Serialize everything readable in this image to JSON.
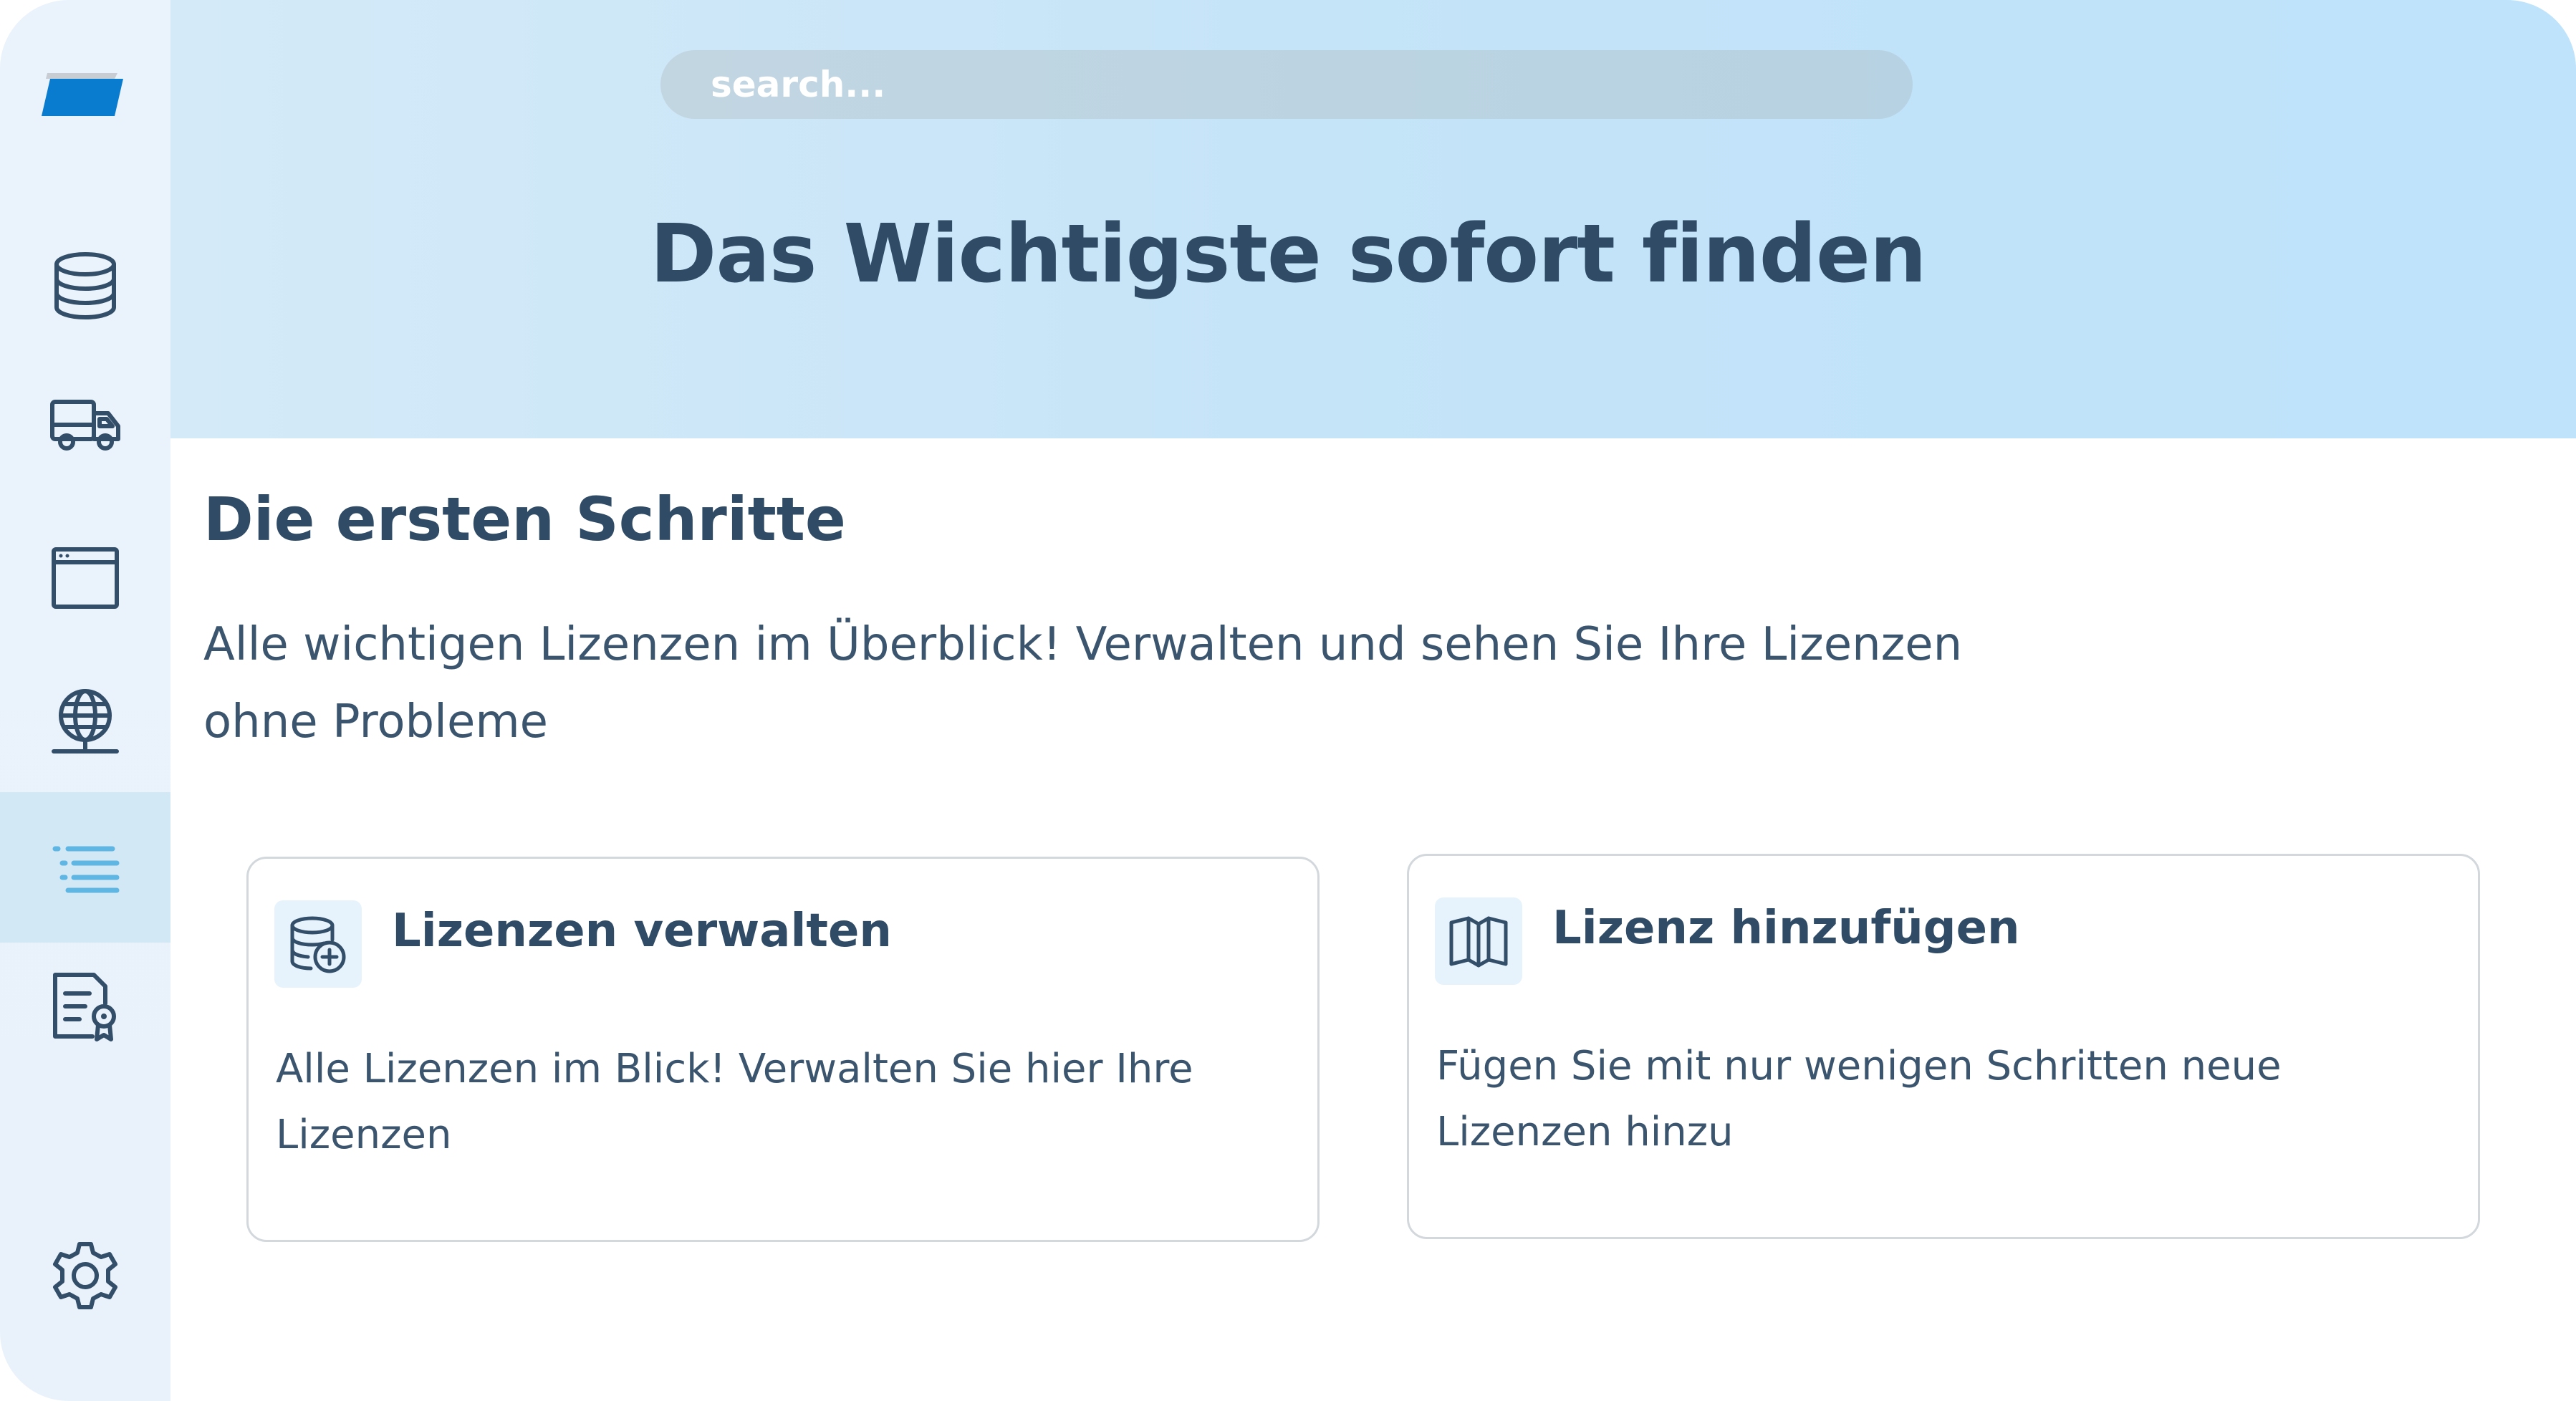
{
  "search": {
    "placeholder": "search..."
  },
  "hero": {
    "title": "Das Wichtigste sofort finden"
  },
  "sidebar": {
    "items": [
      {
        "icon": "database-icon"
      },
      {
        "icon": "truck-icon"
      },
      {
        "icon": "browser-window-icon"
      },
      {
        "icon": "globe-network-icon"
      },
      {
        "icon": "list-icon",
        "active": true
      },
      {
        "icon": "certificate-document-icon"
      },
      {
        "icon": "gear-icon"
      }
    ]
  },
  "content": {
    "section_title": "Die ersten Schritte",
    "section_desc": "Alle wichtigen Lizenzen im Überblick! Verwalten und sehen Sie Ihre Lizenzen ohne Probleme",
    "cards": [
      {
        "icon": "database-add-icon",
        "title": "Lizenzen verwalten",
        "desc": "Alle Lizenzen im Blick! Verwalten Sie hier Ihre Lizenzen"
      },
      {
        "icon": "open-book-icon",
        "title": "Lizenz hinzufügen",
        "desc": "Fügen Sie mit nur wenigen Schritten neue Lizenzen hinzu"
      }
    ]
  },
  "colors": {
    "primary_text": "#2f4b66",
    "accent": "#5fb6e3",
    "logo_blue": "#0a7ccf",
    "hero_bg": "#c3e3f8",
    "sidebar_bg": "#eaf2fb",
    "active_bg": "#d3e8f5"
  }
}
